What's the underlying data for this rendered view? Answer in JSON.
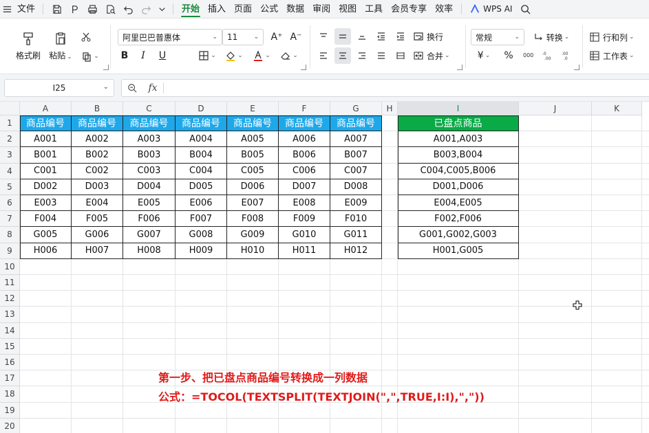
{
  "menubar": {
    "file_label": "文件",
    "tabs": [
      "开始",
      "插入",
      "页面",
      "公式",
      "数据",
      "审阅",
      "视图",
      "工具",
      "会员专享",
      "效率"
    ],
    "active_tab": "开始",
    "wps_ai": "WPS AI"
  },
  "ribbon": {
    "format_painter": "格式刷",
    "paste": "粘贴",
    "font_name": "阿里巴巴普惠体",
    "font_size": "11",
    "bold": "B",
    "italic": "I",
    "underline": "U",
    "wrap": "换行",
    "merge": "合并",
    "number_format": "常规",
    "convert": "转换",
    "rows_cols": "行和列",
    "worksheet": "工作表",
    "percent": "%",
    "yen": "¥"
  },
  "formula_bar": {
    "name_box": "I25",
    "fx": "fx",
    "formula": ""
  },
  "columns": [
    {
      "id": "A",
      "width": 75
    },
    {
      "id": "B",
      "width": 75
    },
    {
      "id": "C",
      "width": 76
    },
    {
      "id": "D",
      "width": 75
    },
    {
      "id": "E",
      "width": 75
    },
    {
      "id": "F",
      "width": 75
    },
    {
      "id": "G",
      "width": 75
    },
    {
      "id": "H",
      "width": 23
    },
    {
      "id": "I",
      "width": 176
    },
    {
      "id": "J",
      "width": 106
    },
    {
      "id": "K",
      "width": 73
    }
  ],
  "rows": [
    "1",
    "2",
    "3",
    "4",
    "5",
    "6",
    "7",
    "8",
    "9",
    "10",
    "11",
    "12",
    "13",
    "14",
    "15",
    "16",
    "17",
    "18",
    "19",
    "20"
  ],
  "selected_column": "I",
  "table": {
    "header": [
      "商品编号",
      "商品编号",
      "商品编号",
      "商品编号",
      "商品编号",
      "商品编号",
      "商品编号"
    ],
    "rows": [
      [
        "A001",
        "A002",
        "A003",
        "A004",
        "A005",
        "A006",
        "A007"
      ],
      [
        "B001",
        "B002",
        "B003",
        "B004",
        "B005",
        "B006",
        "B007"
      ],
      [
        "C001",
        "C002",
        "C003",
        "C004",
        "C005",
        "C006",
        "C007"
      ],
      [
        "D002",
        "D003",
        "D004",
        "D005",
        "D006",
        "D007",
        "D008"
      ],
      [
        "E003",
        "E004",
        "E005",
        "E006",
        "E007",
        "E008",
        "E009"
      ],
      [
        "F004",
        "F005",
        "F006",
        "F007",
        "F008",
        "F009",
        "F010"
      ],
      [
        "G005",
        "G006",
        "G007",
        "G008",
        "G009",
        "G010",
        "G011"
      ],
      [
        "H006",
        "H007",
        "H008",
        "H009",
        "H010",
        "H011",
        "H012"
      ]
    ]
  },
  "inventory": {
    "header": "已盘点商品",
    "values": [
      "A001,A003",
      "B003,B004",
      "C004,C005,B006",
      "D001,D006",
      "E004,E005",
      "F002,F006",
      "G001,G002,G003",
      "H001,G005"
    ]
  },
  "annotation": {
    "line1": "第一步、把已盘点商品编号转换成一列数据",
    "line2": "公式：=TOCOL(TEXTSPLIT(TEXTJOIN(\",\",TRUE,I:I),\",\"))",
    "color": "#e01b1b"
  },
  "colors": {
    "header_blue": "#1ea8ea",
    "header_green": "#0aaa47",
    "accent": "#1a8a3e"
  }
}
